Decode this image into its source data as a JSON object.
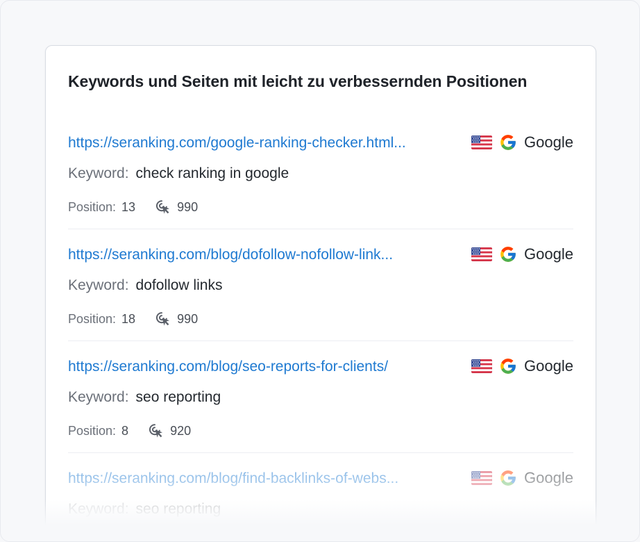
{
  "card": {
    "title": "Keywords und Seiten mit leicht zu verbessernden Positionen"
  },
  "labels": {
    "keyword": "Keyword:",
    "position": "Position:"
  },
  "colors": {
    "link": "#1f7ad1",
    "text": "#24292f",
    "muted": "#6b7079"
  },
  "rows": [
    {
      "url": "https://seranking.com/google-ranking-checker.html...",
      "engine": "Google",
      "flag": "us-flag-icon",
      "keyword": "check ranking in google",
      "position": "13",
      "volume": "990"
    },
    {
      "url": "https://seranking.com/blog/dofollow-nofollow-link...",
      "engine": "Google",
      "flag": "us-flag-icon",
      "keyword": "dofollow links",
      "position": "18",
      "volume": "990"
    },
    {
      "url": "https://seranking.com/blog/seo-reports-for-clients/",
      "engine": "Google",
      "flag": "us-flag-icon",
      "keyword": "seo reporting",
      "position": "8",
      "volume": "920"
    },
    {
      "url": "https://seranking.com/blog/find-backlinks-of-webs...",
      "engine": "Google",
      "flag": "us-flag-icon",
      "keyword": "seo reporting",
      "position": "",
      "volume": ""
    }
  ]
}
